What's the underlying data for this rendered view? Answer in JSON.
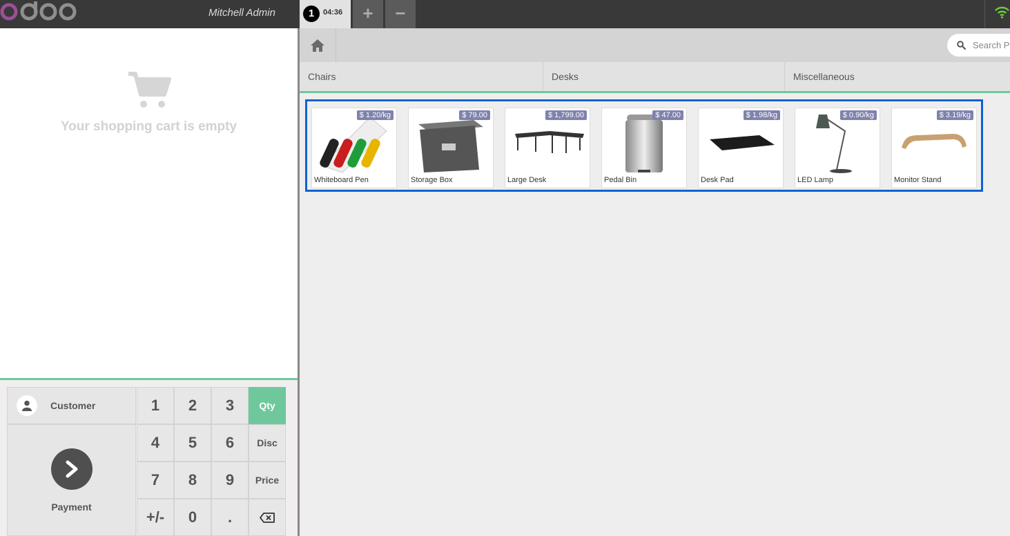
{
  "header": {
    "logo_text": "odoo",
    "user_name": "Mitchell Admin",
    "order_number": "1",
    "order_time": "04:36",
    "add_order_label": "+",
    "remove_order_label": "−"
  },
  "cart": {
    "empty_message": "Your shopping cart is empty"
  },
  "numpad": {
    "customer_label": "Customer",
    "payment_label": "Payment",
    "keys": [
      "1",
      "2",
      "3",
      "4",
      "5",
      "6",
      "7",
      "8",
      "9",
      "+/-",
      "0",
      "."
    ],
    "modes": [
      "Qty",
      "Disc",
      "Price"
    ],
    "active_mode": "Qty",
    "backspace_icon": "backspace-icon"
  },
  "search": {
    "placeholder": "Search Products"
  },
  "categories": [
    "Chairs",
    "Desks",
    "Miscellaneous"
  ],
  "products": [
    {
      "name": "Whiteboard Pen",
      "price": "$ 1.20/kg"
    },
    {
      "name": "Storage Box",
      "price": "$ 79.00"
    },
    {
      "name": "Large Desk",
      "price": "$ 1,799.00"
    },
    {
      "name": "Pedal Bin",
      "price": "$ 47.00"
    },
    {
      "name": "Desk Pad",
      "price": "$ 1.98/kg"
    },
    {
      "name": "LED Lamp",
      "price": "$ 0.90/kg"
    },
    {
      "name": "Monitor Stand",
      "price": "$ 3.19/kg"
    }
  ],
  "colors": {
    "accent": "#6ec89b",
    "topbar": "#393939",
    "price_tag": "#7f82ac",
    "selection": "#0a63d2"
  }
}
